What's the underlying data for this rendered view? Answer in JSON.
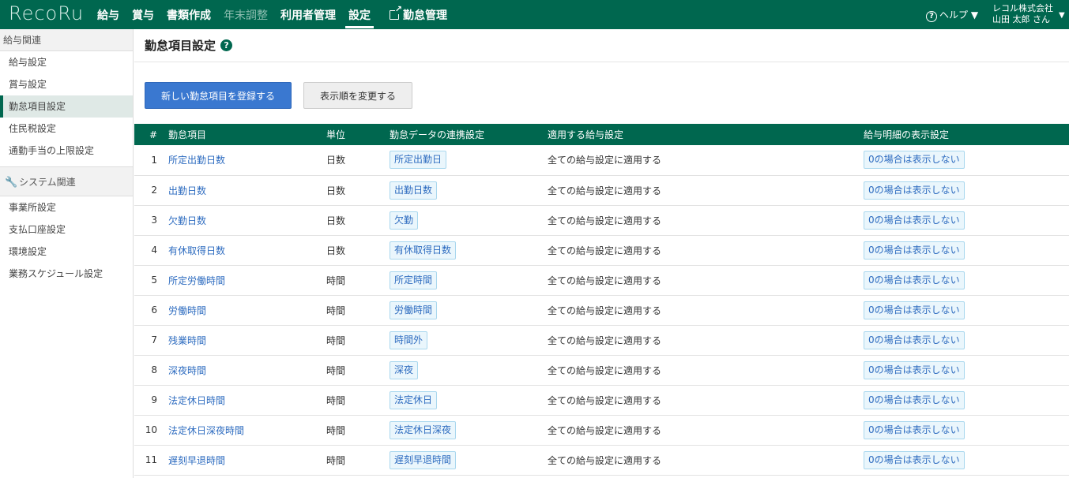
{
  "header": {
    "logo": "RecoRu",
    "nav": [
      {
        "label": "給与"
      },
      {
        "label": "賞与"
      },
      {
        "label": "書類作成"
      },
      {
        "label": "年末調整"
      },
      {
        "label": "利用者管理"
      },
      {
        "label": "設定"
      },
      {
        "label": "勤怠管理"
      }
    ],
    "help": "ヘルプ",
    "company": "レコル株式会社",
    "user": "山田 太郎 さん"
  },
  "sidebar": {
    "group1": "給与関連",
    "items1": [
      {
        "label": "給与設定"
      },
      {
        "label": "賞与設定"
      },
      {
        "label": "勤怠項目設定"
      },
      {
        "label": "住民税設定"
      },
      {
        "label": "通勤手当の上限設定"
      }
    ],
    "group2": "システム関連",
    "items2": [
      {
        "label": "事業所設定"
      },
      {
        "label": "支払口座設定"
      },
      {
        "label": "環境設定"
      },
      {
        "label": "業務スケジュール設定"
      }
    ]
  },
  "main": {
    "title": "勤怠項目設定",
    "help_mark": "?",
    "btn_new": "新しい勤怠項目を登録する",
    "btn_order": "表示順を変更する",
    "columns": {
      "num": "#",
      "item": "勤怠項目",
      "unit": "単位",
      "link": "勤怠データの連携設定",
      "apply": "適用する給与設定",
      "display": "給与明細の表示設定"
    },
    "rows": [
      {
        "num": "1",
        "item": "所定出勤日数",
        "unit": "日数",
        "link": "所定出勤日",
        "apply": "全ての給与設定に適用する",
        "display": "0の場合は表示しない"
      },
      {
        "num": "2",
        "item": "出勤日数",
        "unit": "日数",
        "link": "出勤日数",
        "apply": "全ての給与設定に適用する",
        "display": "0の場合は表示しない"
      },
      {
        "num": "3",
        "item": "欠勤日数",
        "unit": "日数",
        "link": "欠勤",
        "apply": "全ての給与設定に適用する",
        "display": "0の場合は表示しない"
      },
      {
        "num": "4",
        "item": "有休取得日数",
        "unit": "日数",
        "link": "有休取得日数",
        "apply": "全ての給与設定に適用する",
        "display": "0の場合は表示しない"
      },
      {
        "num": "5",
        "item": "所定労働時間",
        "unit": "時間",
        "link": "所定時間",
        "apply": "全ての給与設定に適用する",
        "display": "0の場合は表示しない"
      },
      {
        "num": "6",
        "item": "労働時間",
        "unit": "時間",
        "link": "労働時間",
        "apply": "全ての給与設定に適用する",
        "display": "0の場合は表示しない"
      },
      {
        "num": "7",
        "item": "残業時間",
        "unit": "時間",
        "link": "時間外",
        "apply": "全ての給与設定に適用する",
        "display": "0の場合は表示しない"
      },
      {
        "num": "8",
        "item": "深夜時間",
        "unit": "時間",
        "link": "深夜",
        "apply": "全ての給与設定に適用する",
        "display": "0の場合は表示しない"
      },
      {
        "num": "9",
        "item": "法定休日時間",
        "unit": "時間",
        "link": "法定休日",
        "apply": "全ての給与設定に適用する",
        "display": "0の場合は表示しない"
      },
      {
        "num": "10",
        "item": "法定休日深夜時間",
        "unit": "時間",
        "link": "法定休日深夜",
        "apply": "全ての給与設定に適用する",
        "display": "0の場合は表示しない"
      },
      {
        "num": "11",
        "item": "遅刻早退時間",
        "unit": "時間",
        "link": "遅刻早退時間",
        "apply": "全ての給与設定に適用する",
        "display": "0の場合は表示しない"
      }
    ]
  },
  "colors": {
    "brand": "#00674f",
    "primary_button": "#3a78d0",
    "link": "#2e6cc0"
  }
}
